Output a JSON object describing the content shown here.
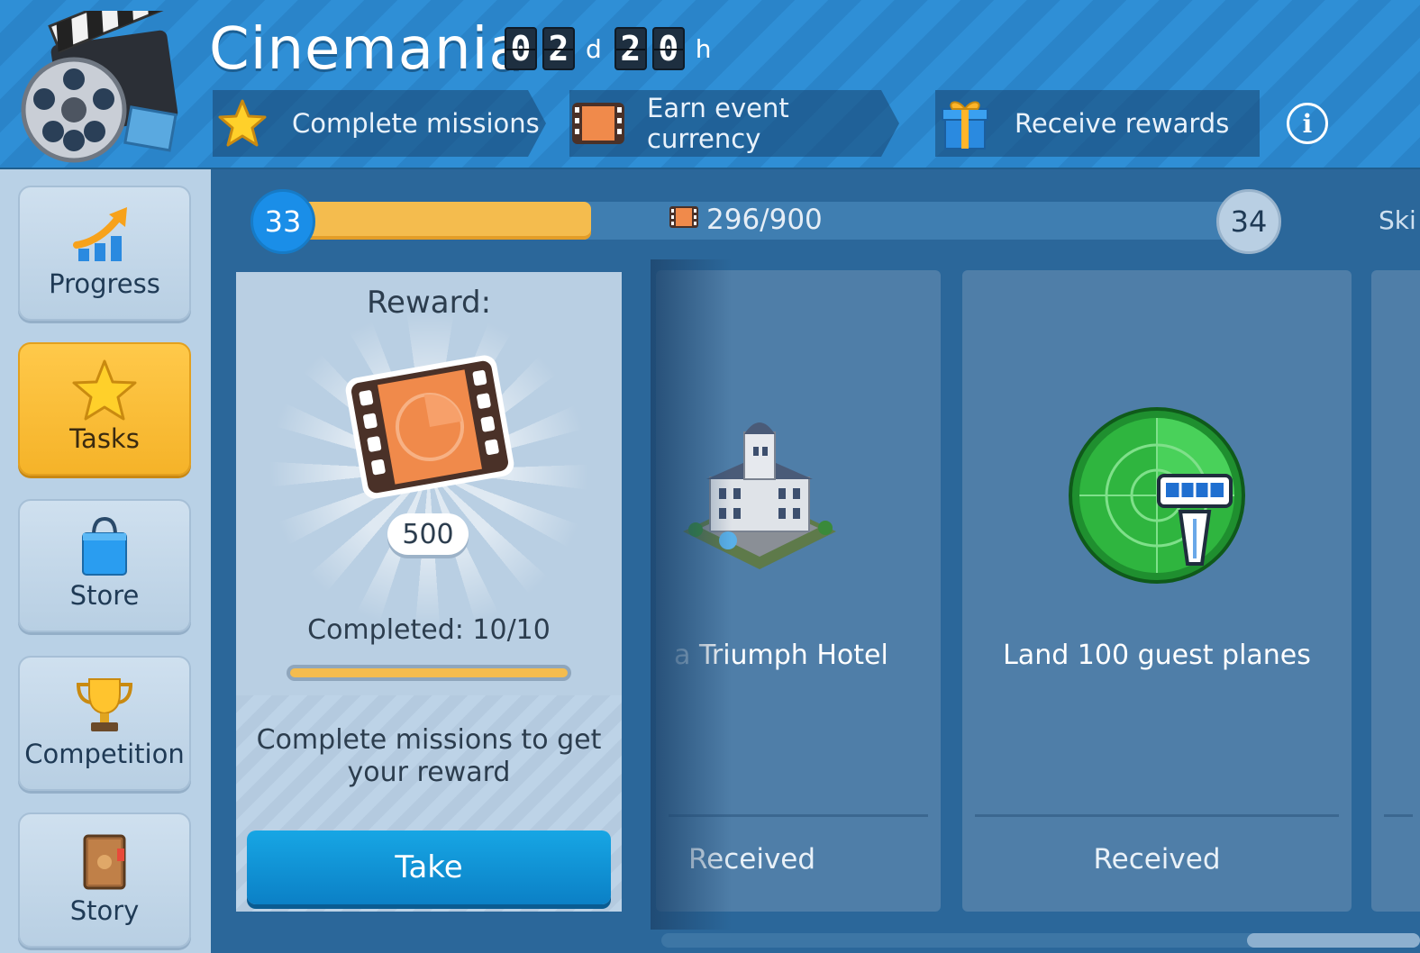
{
  "header": {
    "title": "Cinemania",
    "timer": {
      "days_digits": [
        "0",
        "2"
      ],
      "days_unit": "d",
      "hours_digits": [
        "2",
        "0"
      ],
      "hours_unit": "h"
    },
    "steps": [
      {
        "label": "Complete missions",
        "icon": "star-icon"
      },
      {
        "label": "Earn event currency",
        "icon": "film-currency-icon"
      },
      {
        "label": "Receive rewards",
        "icon": "gift-icon"
      }
    ],
    "info_icon": "info-icon"
  },
  "sidebar": {
    "items": [
      {
        "label": "Progress",
        "icon": "progress-chart-icon",
        "active": false
      },
      {
        "label": "Tasks",
        "icon": "star-icon",
        "active": true
      },
      {
        "label": "Store",
        "icon": "shopping-bag-icon",
        "active": false
      },
      {
        "label": "Competition",
        "icon": "trophy-icon",
        "active": false
      },
      {
        "label": "Story",
        "icon": "book-icon",
        "active": false
      }
    ]
  },
  "progress": {
    "current_level": "33",
    "next_level": "34",
    "count_text": "296/900",
    "fraction": 0.329,
    "skip_label": "Ski"
  },
  "reward_card": {
    "title": "Reward:",
    "amount": "500",
    "completed_text": "Completed: 10/10",
    "completed_fraction": 1.0,
    "description": "Complete missions to get your reward",
    "take_label": "Take"
  },
  "missions": [
    {
      "title_prefix": "a",
      "title": "Triumph Hotel",
      "status": "Received",
      "icon": "hotel-building-icon"
    },
    {
      "title": "Land 100 guest planes",
      "status": "Received",
      "icon": "radar-tower-icon"
    }
  ],
  "colors": {
    "accent_yellow": "#f4bc4e",
    "accent_blue": "#1a8ee8",
    "header_blue": "#2f8fd6",
    "panel_blue": "#2b679a"
  }
}
